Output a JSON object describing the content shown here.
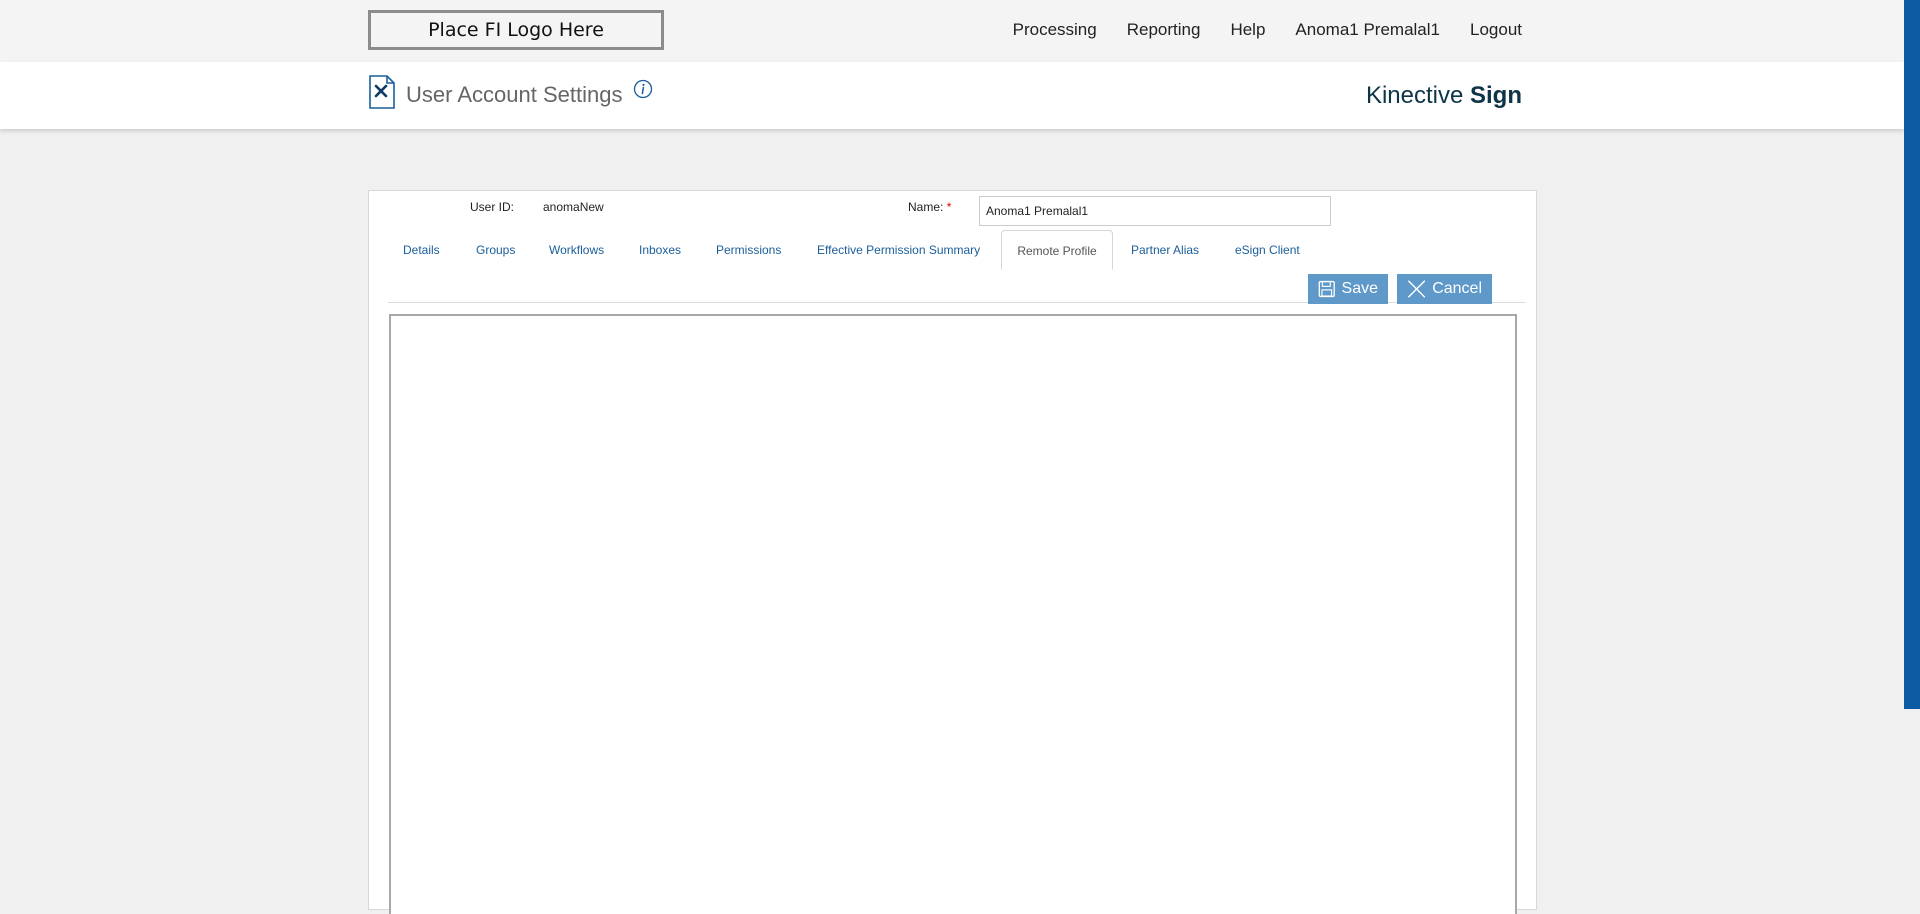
{
  "header": {
    "logo_text": "Place FI Logo Here",
    "nav": [
      "Processing",
      "Reporting",
      "Help",
      "Anoma1 Premalal1",
      "Logout"
    ]
  },
  "subheader": {
    "title": "User Account Settings",
    "brand_light": "Kinective",
    "brand_bold": "Sign"
  },
  "form": {
    "user_id_label": "User ID:",
    "user_id_value": "anomaNew",
    "name_label": "Name:",
    "name_required": "*",
    "name_value": "Anoma1 Premalal1"
  },
  "tabs": [
    "Details",
    "Groups",
    "Workflows",
    "Inboxes",
    "Permissions",
    "Effective Permission Summary",
    "Remote Profile",
    "Partner Alias",
    "eSign Client"
  ],
  "active_tab": "Remote Profile",
  "actions": {
    "save_label": "Save",
    "cancel_label": "Cancel"
  },
  "colors": {
    "accent_stripe": "#0b5aa2",
    "button": "#5e99ca",
    "link": "#1a5e9a"
  },
  "icons": [
    "settings-page-icon",
    "info-icon",
    "save-icon",
    "close-icon"
  ]
}
